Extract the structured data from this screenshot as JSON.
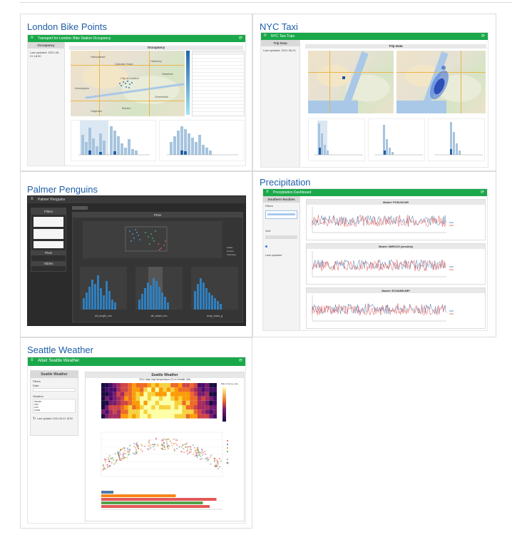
{
  "cards": {
    "london": {
      "title": "London Bike Points",
      "app_title": "Transport for London: Bike Station Occupancy",
      "sidebar_header": "Occupancy",
      "sidebar_text": "Last updated: 2021-06-01 18:00",
      "panel_header": "Occupancy",
      "map_labels": [
        "Hampstead",
        "Camden Town",
        "City of London",
        "Hackney",
        "Stratford",
        "Kensington",
        "Greenwich",
        "Brixton",
        "Clapham"
      ]
    },
    "nyc": {
      "title": "NYC Taxi",
      "app_title": "NYC Taxi Trips",
      "sidebar_header": "Trip Data",
      "sidebar_text": "Last updated: 2021-06-01",
      "panel_header": "Trip Data"
    },
    "penguins": {
      "title": "Palmer Penguins",
      "app_title": "Palmer Penguins",
      "sidebar_header": "Filters",
      "sidebar_sections": [
        "Plots",
        "Tables"
      ],
      "panel_header": "Plots",
      "x_labels": [
        "bill_length_mm",
        "bill_depth_mm",
        "body_mass_g"
      ],
      "legend": [
        "Adelie",
        "Gentoo",
        "Chinstrap"
      ]
    },
    "precip": {
      "title": "Precipitation",
      "app_title": "Precipitation Dashboard",
      "sidebar_header": "Southern Rockies",
      "sidebar_labels": [
        "Filters",
        "Sort",
        "Last updated"
      ],
      "models": [
        "Model: PCM-NCAR",
        "Model: MIROC5 (zmsilva)",
        "Model: ECHAM5-MPI"
      ]
    },
    "seattle": {
      "title": "Seattle Weather",
      "app_title": "Altair Seattle Weather",
      "sidebar_header": "Seattle Weather",
      "sidebar_labels": [
        "Filters",
        "Date",
        "Weather",
        "Last updated: 2021-06-01 18:00"
      ],
      "weather_options": [
        "drizzle",
        "rain",
        "sun",
        "snow"
      ],
      "panel_header": "Seattle Weather",
      "heatmap_title": "2012 daily high temperature (F) in Seattle, WA",
      "legend_title": "Max of temp_max"
    }
  },
  "colors": {
    "title_blue": "#1f5fa8",
    "header_green": "#1aa84a",
    "border": "#dcdcdc"
  }
}
